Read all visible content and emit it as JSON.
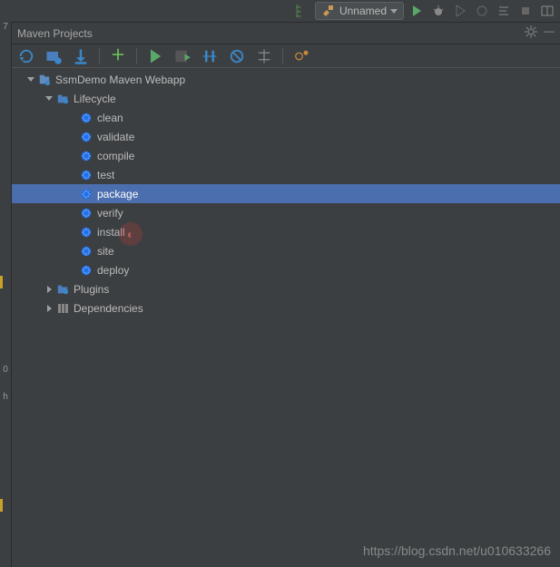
{
  "top_toolbar": {
    "version_indicator": "01\n10\n01",
    "run_config_label": "Unnamed"
  },
  "panel": {
    "title": "Maven Projects"
  },
  "tree": {
    "project": {
      "label": "SsmDemo Maven Webapp",
      "expanded": true,
      "children": {
        "lifecycle": {
          "label": "Lifecycle",
          "expanded": true,
          "phases": [
            {
              "label": "clean"
            },
            {
              "label": "validate"
            },
            {
              "label": "compile"
            },
            {
              "label": "test"
            },
            {
              "label": "package",
              "selected": true
            },
            {
              "label": "verify"
            },
            {
              "label": "install"
            },
            {
              "label": "site"
            },
            {
              "label": "deploy"
            }
          ]
        },
        "plugins": {
          "label": "Plugins",
          "expanded": false
        },
        "dependencies": {
          "label": "Dependencies",
          "expanded": false
        }
      }
    }
  },
  "gutter": {
    "num7": "7",
    "num0": "0",
    "h": "h"
  },
  "watermark": "https://blog.csdn.net/u010633266"
}
